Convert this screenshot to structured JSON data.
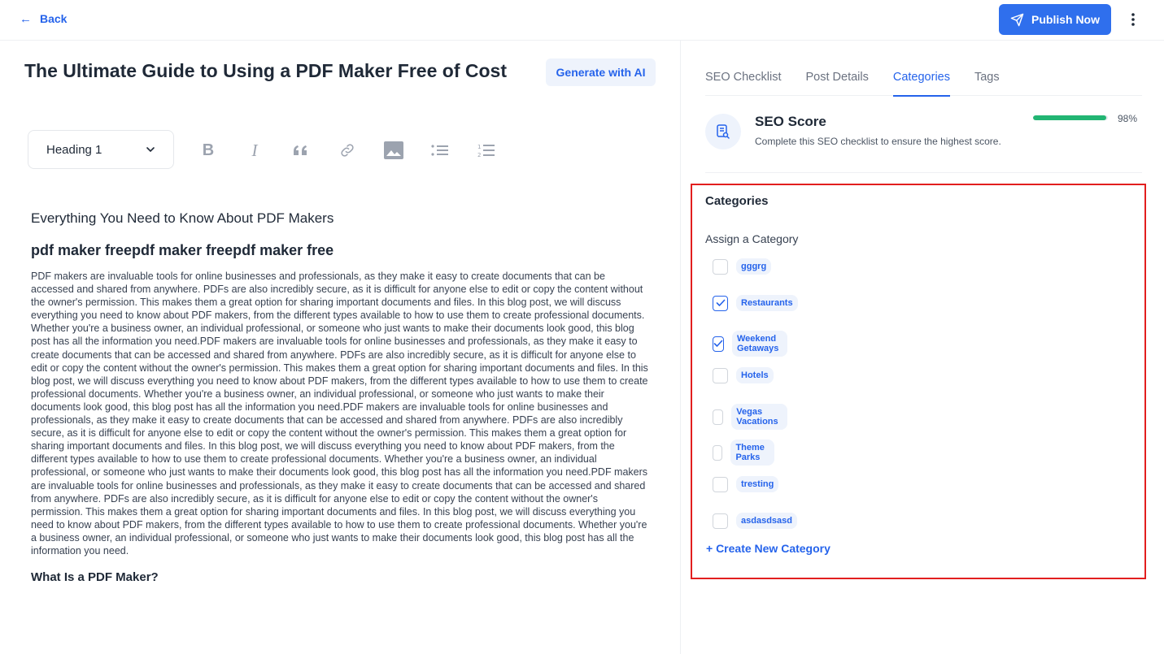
{
  "topbar": {
    "back_label": "Back",
    "publish_label": "Publish Now"
  },
  "editor": {
    "title": "The Ultimate Guide to Using a PDF Maker Free of Cost",
    "generate_ai_label": "Generate with AI",
    "heading_select_value": "Heading 1",
    "toolbar_icons": [
      "bold-icon",
      "italic-icon",
      "quote-icon",
      "link-icon",
      "image-icon",
      "bulleted-list-icon",
      "numbered-list-icon"
    ],
    "h3_first": "Everything You Need to Know About PDF Makers",
    "h2": "pdf maker freepdf maker freepdf maker free",
    "paragraph": "PDF makers are invaluable tools for online businesses and professionals, as they make it easy to create documents that can be accessed and shared from anywhere. PDFs are also incredibly secure, as it is difficult for anyone else to edit or copy the content without the owner's permission. This makes them a great option for sharing important documents and files. In this blog post, we will discuss everything you need to know about PDF makers, from the different types available to how to use them to create professional documents. Whether you're a business owner, an individual professional, or someone who just wants to make their documents look good, this blog post has all the information you need.PDF makers are invaluable tools for online businesses and professionals, as they make it easy to create documents that can be accessed and shared from anywhere. PDFs are also incredibly secure, as it is difficult for anyone else to edit or copy the content without the owner's permission. This makes them a great option for sharing important documents and files. In this blog post, we will discuss everything you need to know about PDF makers, from the different types available to how to use them to create professional documents. Whether you're a business owner, an individual professional, or someone who just wants to make their documents look good, this blog post has all the information you need.PDF makers are invaluable tools for online businesses and professionals, as they make it easy to create documents that can be accessed and shared from anywhere. PDFs are also incredibly secure, as it is difficult for anyone else to edit or copy the content without the owner's permission. This makes them a great option for sharing important documents and files. In this blog post, we will discuss everything you need to know about PDF makers, from the different types available to how to use them to create professional documents. Whether you're a business owner, an individual professional, or someone who just wants to make their documents look good, this blog post has all the information you need.PDF makers are invaluable tools for online businesses and professionals, as they make it easy to create documents that can be accessed and shared from anywhere. PDFs are also incredibly secure, as it is difficult for anyone else to edit or copy the content without the owner's permission. This makes them a great option for sharing important documents and files. In this blog post, we will discuss everything you need to know about PDF makers, from the different types available to how to use them to create professional documents. Whether you're a business owner, an individual professional, or someone who just wants to make their documents look good, this blog post has all the information you need.",
    "h3_next": "What Is a PDF Maker?"
  },
  "panel": {
    "tabs": [
      {
        "label": "SEO Checklist",
        "active": false
      },
      {
        "label": "Post Details",
        "active": false
      },
      {
        "label": "Categories",
        "active": true
      },
      {
        "label": "Tags",
        "active": false
      }
    ],
    "seo": {
      "title": "SEO Score",
      "subtitle": "Complete this SEO checklist to ensure the highest score.",
      "score_pct_label": "98%",
      "score_fraction": 0.98
    },
    "categories": {
      "title": "Categories",
      "assign_label": "Assign a Category",
      "items": [
        {
          "label": "gggrg",
          "checked": false
        },
        {
          "label": "Restaurants",
          "checked": true
        },
        {
          "label": "Weekend Getaways",
          "checked": true
        },
        {
          "label": "Hotels",
          "checked": false
        },
        {
          "label": "Vegas Vacations",
          "checked": false
        },
        {
          "label": "Theme Parks",
          "checked": false
        },
        {
          "label": "tresting",
          "checked": false
        },
        {
          "label": "asdasdsasd",
          "checked": false
        }
      ],
      "create_label": "+ Create New Category"
    },
    "colors": {
      "accent": "#2563eb",
      "score_bar": "#22b573",
      "highlight_border": "#e21e1e"
    }
  }
}
